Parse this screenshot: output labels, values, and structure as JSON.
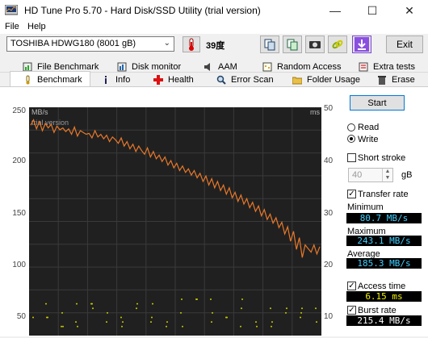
{
  "window": {
    "title": "HD Tune Pro 5.70 - Hard Disk/SSD Utility (trial version)"
  },
  "menu": [
    {
      "label": "File"
    },
    {
      "label": "Help"
    }
  ],
  "toolbar": {
    "drive": "TOSHIBA HDWG180 (8001 gB)",
    "temperature": "39度",
    "exit_label": "Exit"
  },
  "tabs_top": [
    {
      "label": "File Benchmark",
      "icon": "file-benchmark-icon"
    },
    {
      "label": "Disk monitor",
      "icon": "disk-monitor-icon"
    },
    {
      "label": "AAM",
      "icon": "speaker-icon"
    },
    {
      "label": "Random Access",
      "icon": "random-access-icon"
    },
    {
      "label": "Extra tests",
      "icon": "extra-tests-icon"
    }
  ],
  "tabs_bottom": [
    {
      "label": "Benchmark",
      "icon": "thermometer-icon"
    },
    {
      "label": "Info",
      "icon": "info-icon"
    },
    {
      "label": "Health",
      "icon": "health-icon"
    },
    {
      "label": "Error Scan",
      "icon": "magnifier-icon"
    },
    {
      "label": "Folder Usage",
      "icon": "folder-icon"
    },
    {
      "label": "Erase",
      "icon": "trash-icon"
    }
  ],
  "panel": {
    "start_label": "Start",
    "read_label": "Read",
    "write_label": "Write",
    "mode_selected": "Write",
    "short_stroke_label": "Short stroke",
    "short_stroke_checked": false,
    "stroke_value": "40",
    "stroke_unit": "gB",
    "transfer_rate_label": "Transfer rate",
    "transfer_rate_checked": true,
    "minimum_label": "Minimum",
    "minimum_value": "80.7 MB/s",
    "maximum_label": "Maximum",
    "maximum_value": "243.1 MB/s",
    "average_label": "Average",
    "average_value": "185.3 MB/s",
    "access_time_label": "Access time",
    "access_time_checked": true,
    "access_time_value": "6.15 ms",
    "burst_rate_label": "Burst rate",
    "burst_rate_checked": true,
    "burst_rate_value": "215.4 MB/s"
  },
  "chart_data": {
    "type": "line",
    "watermark": "trial version",
    "left_unit": "MB/s",
    "right_unit": "ms",
    "left_ticks": [
      "250",
      "200",
      "150",
      "100",
      "50"
    ],
    "right_ticks": [
      "50",
      "40",
      "30",
      "20",
      "10"
    ],
    "ylim_left": [
      0,
      250
    ],
    "ylim_right": [
      0,
      50
    ],
    "series": [
      {
        "values": [
          232,
          238,
          228,
          236,
          226,
          234,
          229,
          233,
          224,
          231,
          227,
          229,
          225,
          228,
          222,
          230,
          220,
          226,
          224,
          222,
          223,
          218,
          226,
          219,
          222,
          217,
          221,
          214,
          219,
          216,
          212,
          218,
          209,
          214,
          206,
          211,
          203,
          209,
          204,
          200,
          207,
          197,
          203,
          195,
          199,
          192,
          197,
          188,
          193,
          185,
          190,
          182,
          187,
          180,
          184,
          177,
          182,
          174,
          179,
          170,
          176,
          166,
          173,
          163,
          170,
          160,
          166,
          156,
          163,
          152,
          158,
          148,
          155,
          145,
          151,
          141,
          147,
          137,
          143,
          132,
          139,
          128,
          134,
          124,
          130,
          119,
          125,
          112,
          120,
          104,
          115,
          95,
          108,
          86,
          100,
          96,
          92,
          100,
          90,
          98
        ]
      },
      {
        "values": [
          4,
          2,
          6,
          3,
          7,
          2,
          5,
          8,
          3,
          6,
          4,
          2,
          5,
          7,
          3,
          8,
          4,
          2,
          6,
          3,
          5,
          7,
          2,
          4,
          8,
          3,
          6,
          2,
          5,
          4,
          7,
          3,
          6,
          2,
          8,
          4,
          3,
          5,
          6,
          2,
          7,
          4,
          3,
          5,
          8,
          2,
          6,
          4,
          7,
          3
        ]
      }
    ],
    "grid": true
  }
}
